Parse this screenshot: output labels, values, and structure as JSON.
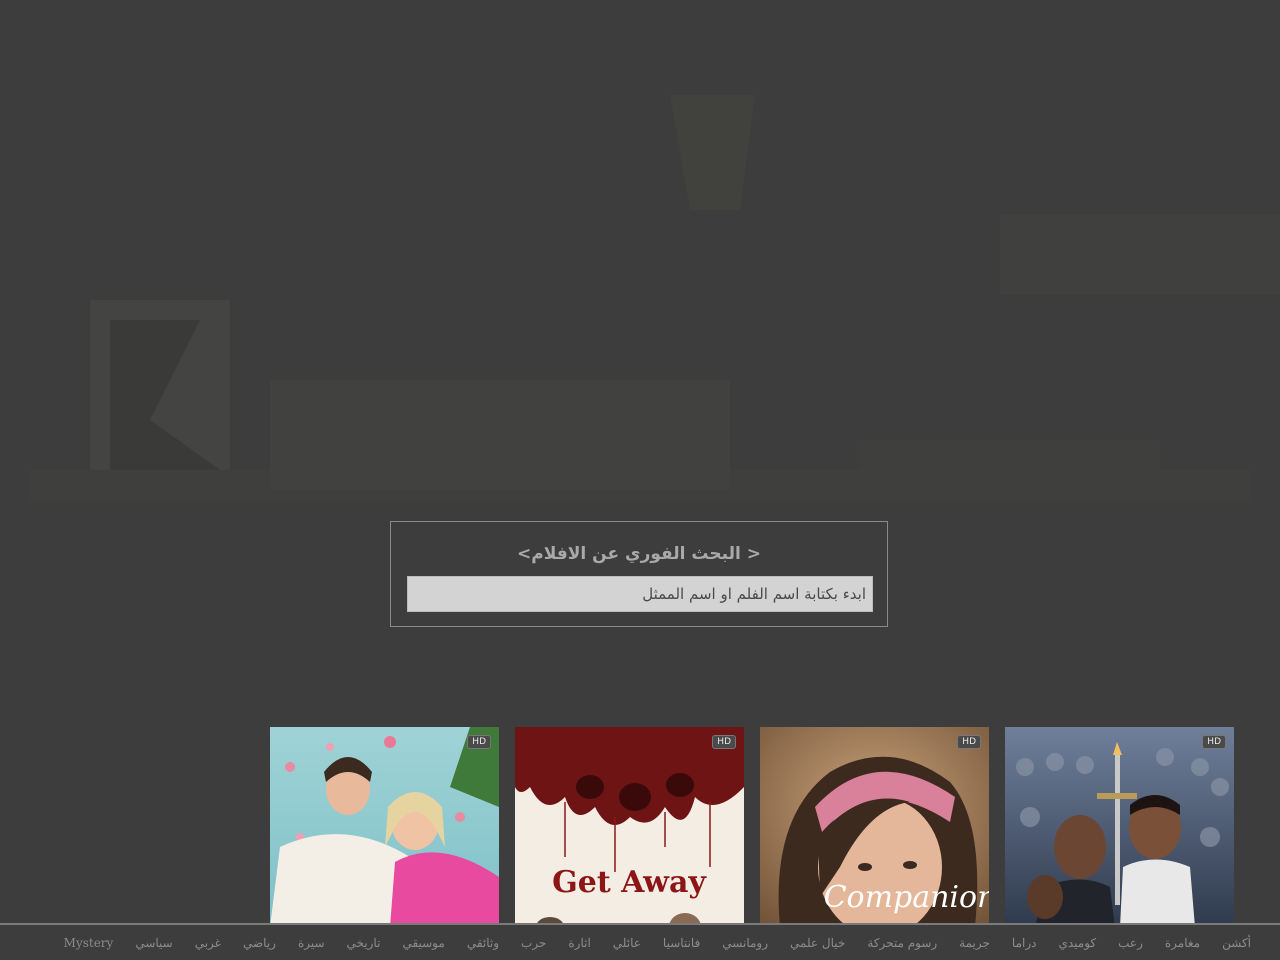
{
  "search": {
    "title": "< البحث الفوري عن الافلام>",
    "placeholder": "ابدء بكتابة اسم الفلم او اسم الممثل"
  },
  "movies": [
    {
      "title": "",
      "badge": "HD"
    },
    {
      "title": "Get Away",
      "badge": "HD"
    },
    {
      "title": "Companion",
      "badge": "HD"
    },
    {
      "title": "",
      "badge": "HD"
    }
  ],
  "genres": [
    "أكشن",
    "مغامرة",
    "رعب",
    "كوميدي",
    "دراما",
    "جريمة",
    "رسوم متحركة",
    "خيال علمي",
    "رومانسي",
    "فانتاسيا",
    "عائلي",
    "اثارة",
    "حرب",
    "وثائقي",
    "موسيقي",
    "تاريخي",
    "سيرة",
    "رياضي",
    "غربي",
    "سياسي",
    "Mystery"
  ],
  "colors": {
    "background": "#3d3d3d",
    "search_border": "#8a8a8a",
    "input_bg": "#d3d3d3",
    "genre_text": "#8c8c8c"
  }
}
